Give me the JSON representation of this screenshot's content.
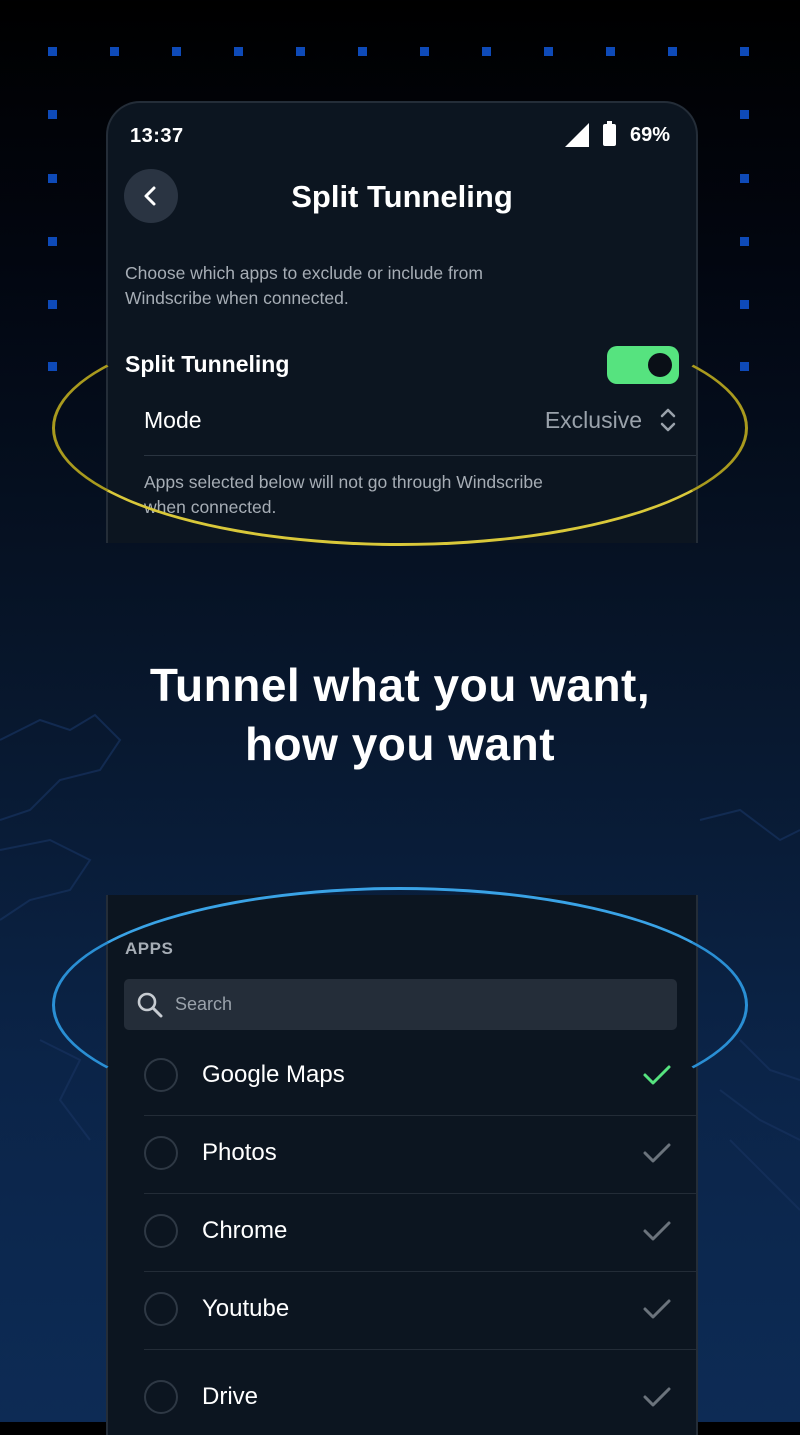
{
  "status_bar": {
    "time": "13:37",
    "battery": "69%"
  },
  "header": {
    "title": "Split Tunneling"
  },
  "settings": {
    "description": "Choose which apps to exclude or include from Windscribe when connected.",
    "toggle_label": "Split Tunneling",
    "toggle_on": true,
    "mode_label": "Mode",
    "mode_value": "Exclusive",
    "mode_note": "Apps selected below will not go through Windscribe when connected."
  },
  "headline": {
    "line1": "Tunnel what you want,",
    "line2": "how you want"
  },
  "apps": {
    "section_label": "APPS",
    "search_placeholder": "Search",
    "items": [
      {
        "name": "Google Maps",
        "selected": true
      },
      {
        "name": "Photos",
        "selected": false
      },
      {
        "name": "Chrome",
        "selected": false
      },
      {
        "name": "Youtube",
        "selected": false
      },
      {
        "name": "Drive",
        "selected": false
      }
    ]
  },
  "colors": {
    "toggle_on": "#56e37f",
    "check_selected": "#56e37f",
    "check_unselected": "#6b737c",
    "ring_top": "#d9c83a",
    "ring_bottom": "#3aa3e6"
  },
  "icons": [
    "back-arrow-icon",
    "signal-icon",
    "battery-icon",
    "up-down-chevron-icon",
    "search-icon",
    "check-icon"
  ]
}
